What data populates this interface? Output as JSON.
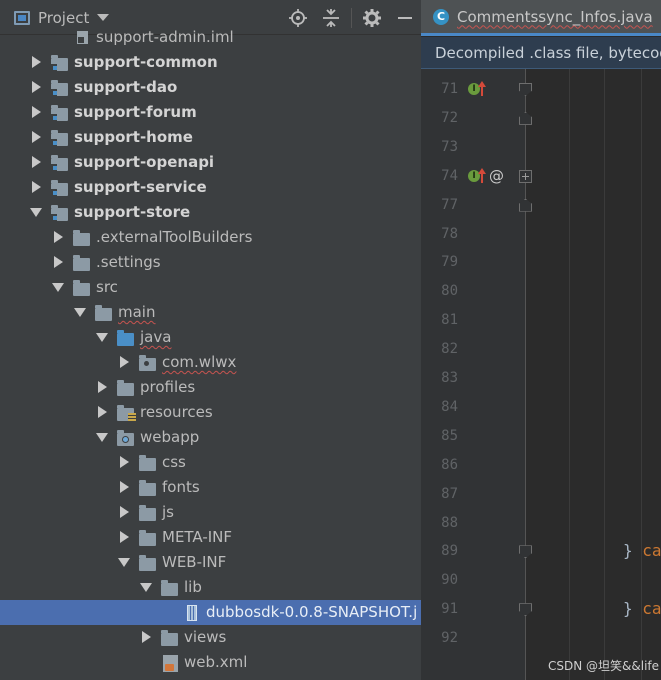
{
  "project_panel": {
    "title": "Project",
    "tools": [
      "locate-icon",
      "collapse-all-icon",
      "gear-icon",
      "hide-icon"
    ]
  },
  "tree": [
    {
      "label": "support-admin.iml",
      "kind": "file",
      "depth": 2,
      "arrow": "none",
      "bold": false
    },
    {
      "label": "support-common",
      "kind": "module",
      "depth": 1,
      "arrow": "right",
      "bold": true
    },
    {
      "label": "support-dao",
      "kind": "module",
      "depth": 1,
      "arrow": "right",
      "bold": true
    },
    {
      "label": "support-forum",
      "kind": "module",
      "depth": 1,
      "arrow": "right",
      "bold": true
    },
    {
      "label": "support-home",
      "kind": "module",
      "depth": 1,
      "arrow": "right",
      "bold": true
    },
    {
      "label": "support-openapi",
      "kind": "module",
      "depth": 1,
      "arrow": "right",
      "bold": true
    },
    {
      "label": "support-service",
      "kind": "module",
      "depth": 1,
      "arrow": "right",
      "bold": true
    },
    {
      "label": "support-store",
      "kind": "module",
      "depth": 1,
      "arrow": "down",
      "bold": true
    },
    {
      "label": ".externalToolBuilders",
      "kind": "folder",
      "depth": 2,
      "arrow": "right",
      "bold": false
    },
    {
      "label": ".settings",
      "kind": "folder",
      "depth": 2,
      "arrow": "right",
      "bold": false
    },
    {
      "label": "src",
      "kind": "folder",
      "depth": 2,
      "arrow": "down",
      "bold": false
    },
    {
      "label": "main",
      "kind": "folder",
      "depth": 3,
      "arrow": "down",
      "bold": false,
      "squiggle": true
    },
    {
      "label": "java",
      "kind": "source-folder",
      "depth": 4,
      "arrow": "down",
      "bold": false,
      "squiggle": true
    },
    {
      "label": "com.wlwx",
      "kind": "package",
      "depth": 5,
      "arrow": "right",
      "bold": false,
      "squiggle": true
    },
    {
      "label": "profiles",
      "kind": "folder",
      "depth": 4,
      "arrow": "right",
      "bold": false
    },
    {
      "label": "resources",
      "kind": "resources",
      "depth": 4,
      "arrow": "right",
      "bold": false
    },
    {
      "label": "webapp",
      "kind": "web",
      "depth": 4,
      "arrow": "down",
      "bold": false
    },
    {
      "label": "css",
      "kind": "folder",
      "depth": 5,
      "arrow": "right",
      "bold": false
    },
    {
      "label": "fonts",
      "kind": "folder",
      "depth": 5,
      "arrow": "right",
      "bold": false
    },
    {
      "label": "js",
      "kind": "folder",
      "depth": 5,
      "arrow": "right",
      "bold": false
    },
    {
      "label": "META-INF",
      "kind": "folder",
      "depth": 5,
      "arrow": "right",
      "bold": false
    },
    {
      "label": "WEB-INF",
      "kind": "folder",
      "depth": 5,
      "arrow": "down",
      "bold": false
    },
    {
      "label": "lib",
      "kind": "folder",
      "depth": 6,
      "arrow": "down",
      "bold": false
    },
    {
      "label": "dubbosdk-0.0.8-SNAPSHOT.j",
      "kind": "jar",
      "depth": 7,
      "arrow": "none",
      "bold": false,
      "selected": true
    },
    {
      "label": "views",
      "kind": "folder",
      "depth": 6,
      "arrow": "right",
      "bold": false
    },
    {
      "label": "web.xml",
      "kind": "xml",
      "depth": 6,
      "arrow": "none",
      "bold": false
    }
  ],
  "editor": {
    "tab_label": "Commentssync_Infos.java",
    "tab_badge": "C",
    "banner_text": "Decompiled .class file, bytecod",
    "lines": [
      {
        "num": "71",
        "impl": true,
        "override": true,
        "at": false,
        "fold": "start",
        "code": ""
      },
      {
        "num": "72",
        "impl": false,
        "override": false,
        "at": false,
        "fold": "end",
        "code": ""
      },
      {
        "num": "73",
        "impl": false,
        "override": false,
        "at": false,
        "fold": "",
        "code": ""
      },
      {
        "num": "74",
        "impl": true,
        "override": true,
        "at": true,
        "fold": "plus",
        "code": ""
      },
      {
        "num": "77",
        "impl": false,
        "override": false,
        "at": false,
        "fold": "end",
        "code": ""
      },
      {
        "num": "78",
        "impl": false,
        "override": false,
        "at": false,
        "fold": "",
        "code": ""
      },
      {
        "num": "79",
        "impl": false,
        "override": false,
        "at": false,
        "fold": "",
        "code": ""
      },
      {
        "num": "80",
        "impl": false,
        "override": false,
        "at": false,
        "fold": "",
        "code": ""
      },
      {
        "num": "81",
        "impl": false,
        "override": false,
        "at": false,
        "fold": "",
        "code": ""
      },
      {
        "num": "82",
        "impl": false,
        "override": false,
        "at": false,
        "fold": "",
        "code": ""
      },
      {
        "num": "83",
        "impl": false,
        "override": false,
        "at": false,
        "fold": "",
        "code": ""
      },
      {
        "num": "84",
        "impl": false,
        "override": false,
        "at": false,
        "fold": "",
        "code": ""
      },
      {
        "num": "85",
        "impl": false,
        "override": false,
        "at": false,
        "fold": "",
        "code": ""
      },
      {
        "num": "86",
        "impl": false,
        "override": false,
        "at": false,
        "fold": "",
        "code": ""
      },
      {
        "num": "87",
        "impl": false,
        "override": false,
        "at": false,
        "fold": "",
        "code": ""
      },
      {
        "num": "88",
        "impl": false,
        "override": false,
        "at": false,
        "fold": "",
        "code": ""
      },
      {
        "num": "89",
        "impl": false,
        "override": false,
        "at": false,
        "fold": "start",
        "code": "} ca"
      },
      {
        "num": "90",
        "impl": false,
        "override": false,
        "at": false,
        "fold": "",
        "code": ""
      },
      {
        "num": "91",
        "impl": false,
        "override": false,
        "at": false,
        "fold": "start",
        "code": "} ca"
      },
      {
        "num": "92",
        "impl": false,
        "override": false,
        "at": false,
        "fold": "",
        "code": ""
      }
    ]
  },
  "watermark": "CSDN @坦笑&&life"
}
